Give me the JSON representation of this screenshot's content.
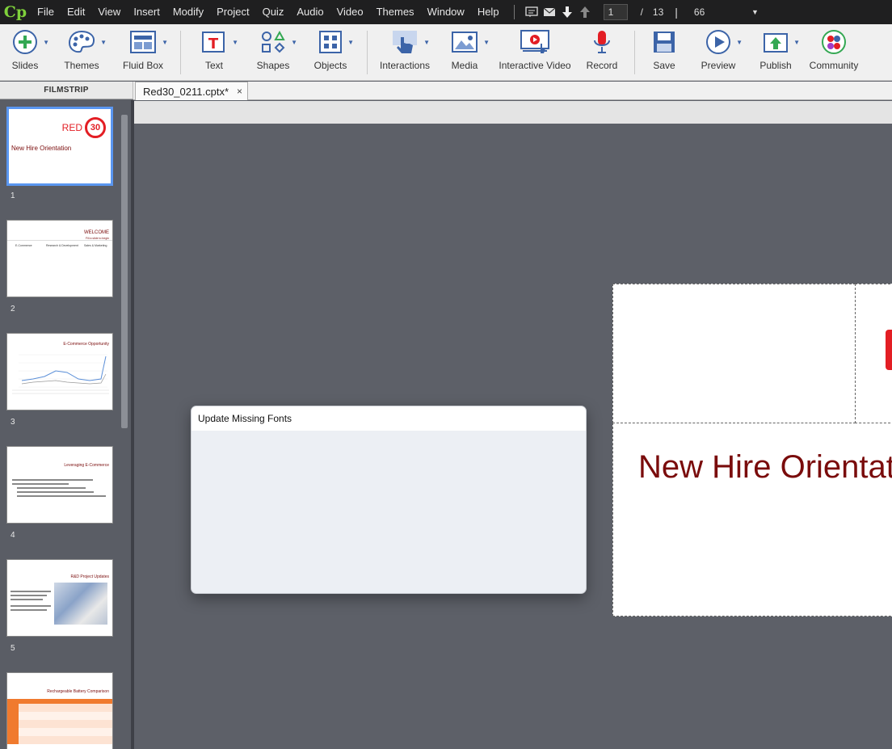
{
  "app": {
    "logo": "Cp",
    "menus": [
      "File",
      "Edit",
      "View",
      "Insert",
      "Modify",
      "Project",
      "Quiz",
      "Audio",
      "Video",
      "Themes",
      "Window",
      "Help"
    ],
    "current_slide": "1",
    "slide_separator": "/",
    "total_slides": "13",
    "divider": "|",
    "zoom": "66"
  },
  "toolbar": {
    "slides": "Slides",
    "themes": "Themes",
    "fluid_box": "Fluid Box",
    "text": "Text",
    "shapes": "Shapes",
    "objects": "Objects",
    "interactions": "Interactions",
    "media": "Media",
    "interactive_video": "Interactive Video",
    "record": "Record",
    "save": "Save",
    "preview": "Preview",
    "publish": "Publish",
    "community": "Community"
  },
  "filmstrip": {
    "header": "FILMSTRIP",
    "thumbnails": [
      {
        "number": "1",
        "title": "New Hire Orientation",
        "logo_text": "RED",
        "logo_num": "30"
      },
      {
        "number": "2",
        "title": "WELCOME",
        "subtitle": "Fill a slide to begin",
        "cols": [
          "E-Commerce",
          "Research & Development",
          "Sales & Marketing"
        ]
      },
      {
        "number": "3",
        "title": "E-Commerce Opportunity"
      },
      {
        "number": "4",
        "title": "Leveraging E-Commerce"
      },
      {
        "number": "5",
        "title": "R&D Project Updates"
      },
      {
        "number": "6",
        "title": "Rechargeable Battery Comparison"
      }
    ]
  },
  "tabs": {
    "document": "Red30_0211.cptx*",
    "close": "×"
  },
  "slide": {
    "title": "New Hire Orientat"
  },
  "dialog": {
    "title": "Update Missing Fonts"
  },
  "colors": {
    "accent_blue": "#3c64a8",
    "brand_red": "#e31e24",
    "title_red": "#7a0c0c",
    "selection": "#5a96f0"
  }
}
